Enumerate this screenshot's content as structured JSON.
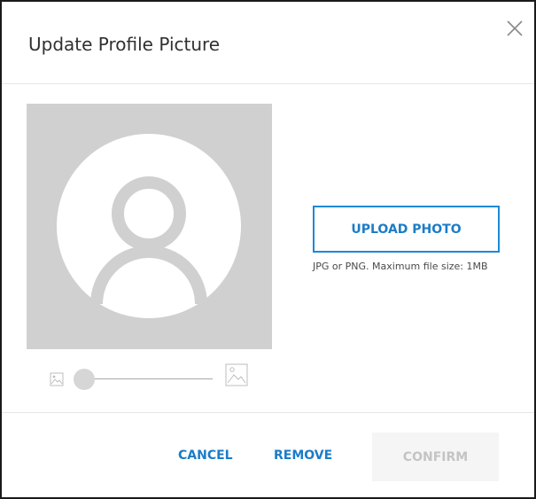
{
  "dialog": {
    "title": "Update Profile Picture",
    "close_icon": "close-icon"
  },
  "preview": {
    "placeholder_icon": "user-avatar-placeholder-icon",
    "background_color": "#d0d0d0"
  },
  "zoom": {
    "small_icon": "image-small-icon",
    "large_icon": "image-large-icon",
    "level_fraction": 0
  },
  "upload": {
    "button_label": "UPLOAD PHOTO",
    "hint": "JPG or PNG. Maximum file size: 1MB"
  },
  "footer": {
    "cancel_label": "CANCEL",
    "remove_label": "REMOVE",
    "confirm_label": "CONFIRM"
  },
  "colors": {
    "accent": "#1c7cc7",
    "disabled_text": "#c4c4c4",
    "disabled_bg": "#f5f5f5"
  }
}
